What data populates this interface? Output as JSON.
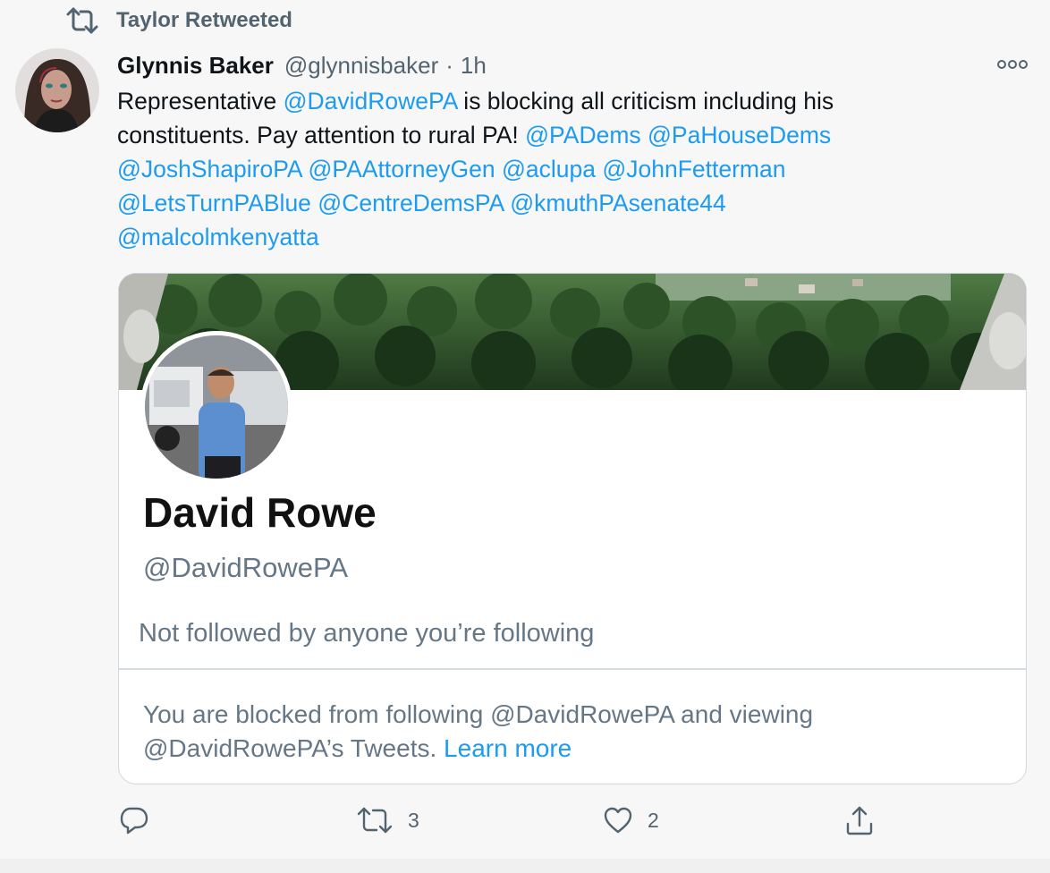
{
  "retweet": {
    "label": "Taylor Retweeted"
  },
  "tweet": {
    "author_name": "Glynnis Baker",
    "author_handle": "@glynnisbaker",
    "separator": "·",
    "time": "1h",
    "text": [
      {
        "t": "Representative ",
        "m": false
      },
      {
        "t": "@DavidRowePA",
        "m": true
      },
      {
        "t": " is blocking all criticism including his",
        "m": false
      },
      {
        "br": true
      },
      {
        "t": "constituents. Pay attention to rural PA! ",
        "m": false
      },
      {
        "t": "@PADems",
        "m": true
      },
      {
        "t": " ",
        "m": false
      },
      {
        "t": "@PaHouseDems",
        "m": true
      },
      {
        "br": true
      },
      {
        "t": "@JoshShapiroPA",
        "m": true
      },
      {
        "t": " ",
        "m": false
      },
      {
        "t": "@PAAttorneyGen",
        "m": true
      },
      {
        "t": " ",
        "m": false
      },
      {
        "t": "@aclupa",
        "m": true
      },
      {
        "t": " ",
        "m": false
      },
      {
        "t": "@JohnFetterman",
        "m": true
      },
      {
        "br": true
      },
      {
        "t": "@LetsTurnPABlue",
        "m": true
      },
      {
        "t": " ",
        "m": false
      },
      {
        "t": "@CentreDemsPA",
        "m": true
      },
      {
        "t": " ",
        "m": false
      },
      {
        "t": "@kmuthPAsenate44",
        "m": true
      },
      {
        "br": true
      },
      {
        "t": "@malcolmkenyatta",
        "m": true
      }
    ]
  },
  "card": {
    "profile_name": "David Rowe",
    "profile_handle": "@DavidRowePA",
    "followed_note": "Not followed by anyone you’re following",
    "blocked_prefix": "You are blocked from following @DavidRowePA and viewing",
    "blocked_suffix": "@DavidRowePA’s Tweets.",
    "learn_more": "Learn more"
  },
  "actions": {
    "reply_count": "",
    "retweet_count": "3",
    "like_count": "2"
  },
  "icons": {
    "retweet": "retweet-icon",
    "more": "more-icon",
    "reply": "reply-icon",
    "like": "heart-icon",
    "share": "share-icon"
  },
  "colors": {
    "link": "#1d9bf0",
    "secondary_text": "#536471",
    "card_border": "#cfd9de",
    "page_bg": "#f7f7f7"
  }
}
